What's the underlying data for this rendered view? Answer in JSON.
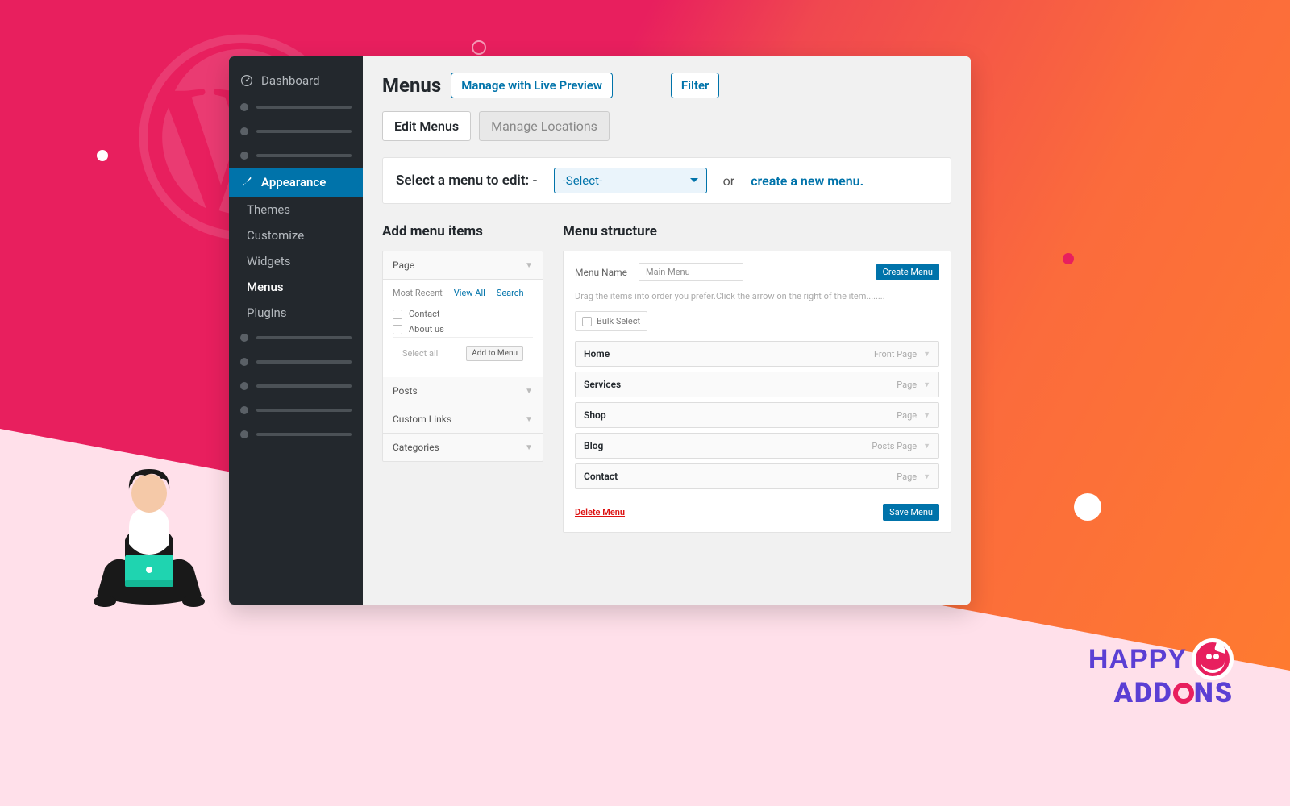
{
  "sidebar": {
    "dashboard": "Dashboard",
    "appearance": "Appearance",
    "sub": [
      "Themes",
      "Customize",
      "Widgets",
      "Menus"
    ],
    "plugins": "Plugins"
  },
  "header": {
    "title": "Menus",
    "manage_preview": "Manage with Live Preview",
    "filter": "Filter"
  },
  "tabs": {
    "edit": "Edit Menus",
    "manage": "Manage Locations"
  },
  "selectbar": {
    "label": "Select a menu to edit: -",
    "select": "-Select-",
    "or": "or",
    "create": "create a new menu."
  },
  "left": {
    "title": "Add menu items",
    "acc": [
      "Page",
      "Posts",
      "Custom Links",
      "Categories"
    ],
    "mini": {
      "mr": "Most Recent",
      "va": "View All",
      "s": "Search"
    },
    "items": [
      "Contact",
      "About us"
    ],
    "select_all": "Select all",
    "add": "Add to Menu"
  },
  "right": {
    "title": "Menu structure",
    "name_lbl": "Menu Name",
    "name_val": "Main Menu",
    "create_btn": "Create Menu",
    "hint": "Drag the items into order  you prefer.Click the arrow on the right of the item........",
    "bulk": "Bulk Select",
    "items": [
      {
        "l": "Home",
        "r": "Front Page"
      },
      {
        "l": "Services",
        "r": "Page"
      },
      {
        "l": "Shop",
        "r": "Page"
      },
      {
        "l": "Blog",
        "r": "Posts Page"
      },
      {
        "l": "Contact",
        "r": "Page"
      }
    ],
    "delete": "Delete Menu",
    "save": "Save Menu"
  },
  "brand": {
    "top": "HAPPY",
    "bottom_a": "ADD",
    "bottom_b": "NS"
  }
}
